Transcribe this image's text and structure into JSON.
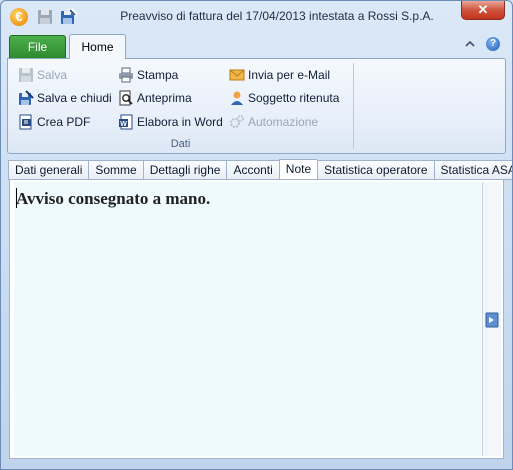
{
  "window": {
    "title": "Preavviso di fattura del 17/04/2013 intestata a Rossi S.p.A.",
    "app_icon_glyph": "€",
    "close_glyph": "✕"
  },
  "ribbon": {
    "file_tab": "File",
    "home_tab": "Home",
    "help_glyph": "?",
    "group_label": "Dati",
    "buttons": {
      "salva": "Salva",
      "salva_chiudi": "Salva e chiudi",
      "crea_pdf": "Crea PDF",
      "stampa": "Stampa",
      "anteprima": "Anteprima",
      "elabora_word": "Elabora in Word",
      "invia_email": "Invia per e-Mail",
      "soggetto_ritenuta": "Soggetto ritenuta",
      "automazione": "Automazione"
    }
  },
  "tabs": [
    "Dati generali",
    "Somme",
    "Dettagli righe",
    "Acconti",
    "Note",
    "Statistica operatore",
    "Statistica ASA"
  ],
  "active_tab_index": 4,
  "note": {
    "text": "Avviso consegnato a mano."
  },
  "colors": {
    "file_tab": "#2d8b2e",
    "close_button": "#c3341c",
    "note_background": "#eefafe"
  }
}
